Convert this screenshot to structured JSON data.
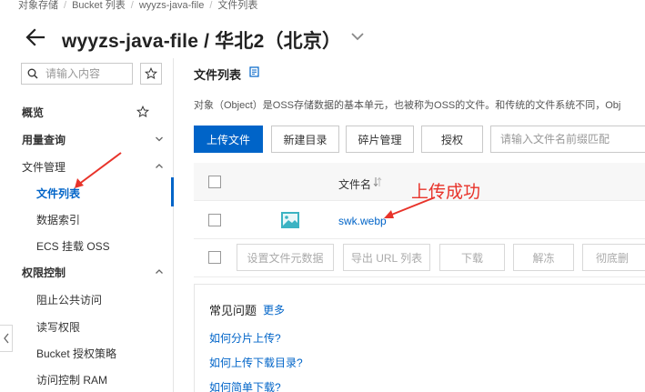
{
  "breadcrumb": [
    "对象存储",
    "Bucket 列表",
    "wyyzs-java-file",
    "文件列表"
  ],
  "header": {
    "title": "wyyzs-java-file / 华北2（北京）"
  },
  "sidebar": {
    "search_placeholder": "请输入内容",
    "items": [
      {
        "label": "概览"
      },
      {
        "label": "用量查询"
      },
      {
        "label": "文件管理"
      },
      {
        "label": "文件列表"
      },
      {
        "label": "数据索引"
      },
      {
        "label": "ECS 挂载 OSS"
      },
      {
        "label": "权限控制"
      },
      {
        "label": "阻止公共访问"
      },
      {
        "label": "读写权限"
      },
      {
        "label": "Bucket 授权策略"
      },
      {
        "label": "访问控制 RAM"
      }
    ]
  },
  "main": {
    "section_title": "文件列表",
    "description": "对象（Object）是OSS存储数据的基本单元，也被称为OSS的文件。和传统的文件系统不同，Obj",
    "toolbar": {
      "upload": "上传文件",
      "new_dir": "新建目录",
      "fragments": "碎片管理",
      "authorize": "授权",
      "filter_placeholder": "请输入文件名前缀匹配"
    },
    "table": {
      "col_name": "文件名",
      "file_name": "swk.webp",
      "actions": [
        "设置文件元数据",
        "导出 URL 列表",
        "下载",
        "解冻",
        "彻底删"
      ]
    },
    "faq": {
      "title": "常见问题",
      "more": "更多",
      "links": [
        "如何分片上传?",
        "如何上传下载目录?",
        "如何简单下载?"
      ]
    }
  },
  "annotation": {
    "text": "上传成功",
    "color": "#e8332a"
  },
  "colors": {
    "accent": "#0064c8",
    "annotation": "#e8332a"
  }
}
